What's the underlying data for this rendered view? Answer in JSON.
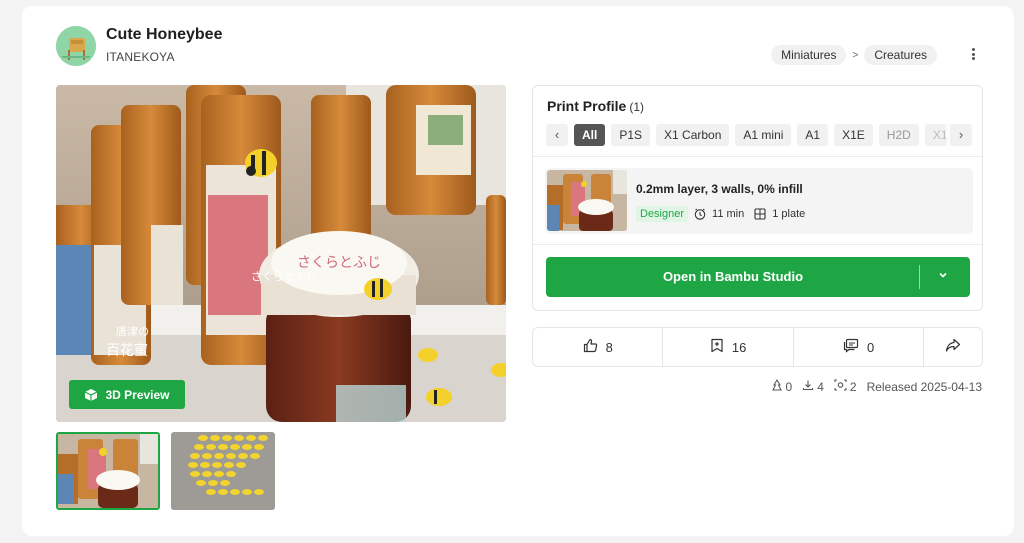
{
  "header": {
    "title": "Cute Honeybee",
    "author": "ITANEKOYA",
    "breadcrumbs": [
      "Miniatures",
      "Creatures"
    ],
    "breadcrumb_separator": ">"
  },
  "gallery": {
    "preview_button": "3D Preview",
    "hero_jar_label": "さくらとふじ",
    "hero_bottle_label_line1": "唐津の",
    "hero_bottle_label_line2": "百花蜜",
    "hero_bottle_label_right": "さくらとふじ"
  },
  "print_profile": {
    "title": "Print Profile",
    "count": "(1)",
    "tabs": [
      "All",
      "P1S",
      "X1 Carbon",
      "A1 mini",
      "A1",
      "X1E",
      "H2D",
      "X1"
    ],
    "active_tab": "All",
    "profile": {
      "name": "0.2mm layer, 3 walls, 0% infill",
      "badge": "Designer",
      "time": "11 min",
      "plates": "1 plate"
    },
    "open_button": "Open in Bambu Studio"
  },
  "stats": {
    "likes": "8",
    "collects": "16",
    "comments": "0"
  },
  "footer": {
    "boosts": "0",
    "downloads": "4",
    "prints": "2",
    "released": "Released 2025-04-13"
  },
  "colors": {
    "accent": "#1fa644",
    "badge_bg": "#e0f5e6"
  }
}
